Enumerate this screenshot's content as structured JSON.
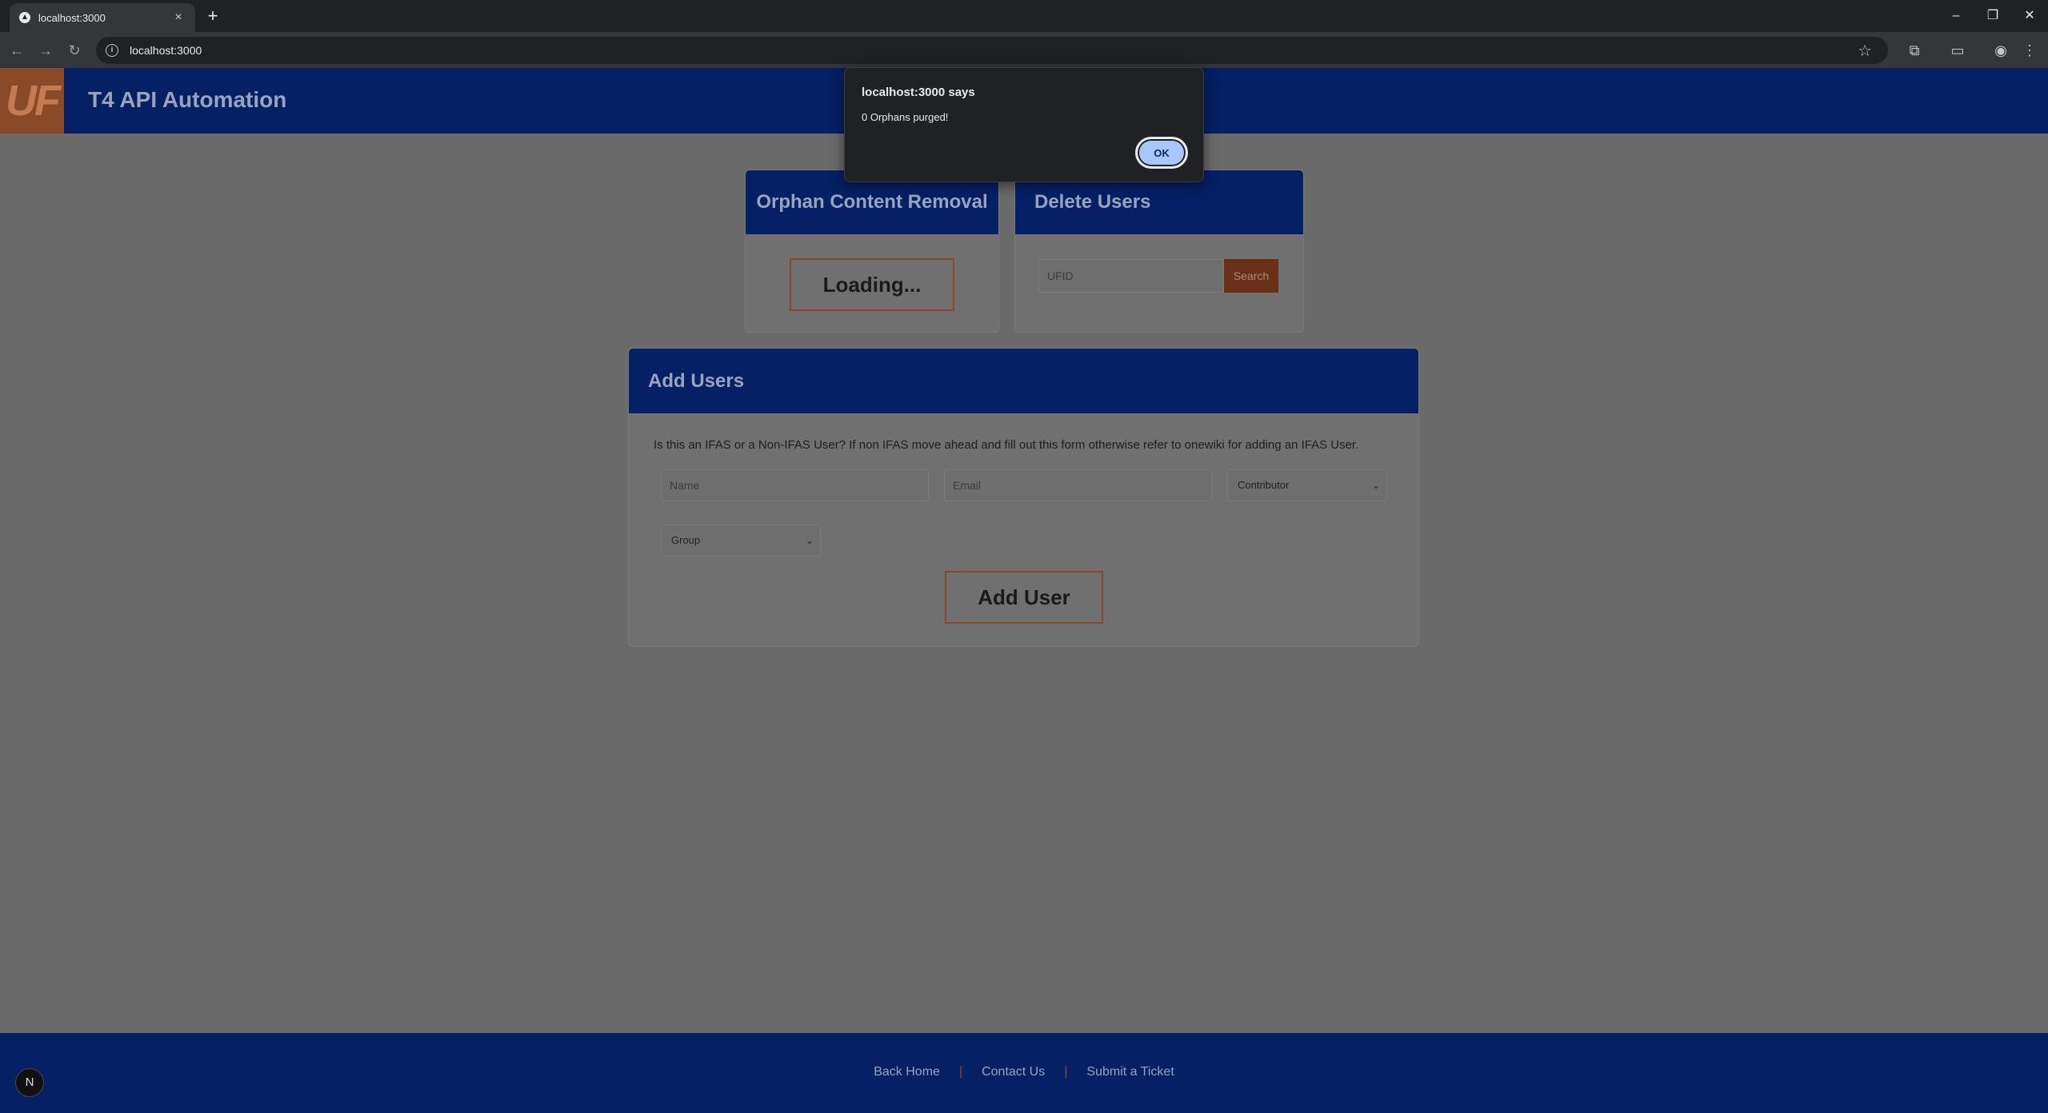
{
  "browser": {
    "tab_title": "localhost:3000",
    "url": "localhost:3000",
    "new_tab": "+",
    "close_tab": "×"
  },
  "header": {
    "logo": "UF",
    "title": "T4 API Automation"
  },
  "orphan_card": {
    "title": "Orphan Content Removal",
    "button_label": "Loading..."
  },
  "delete_card": {
    "title": "Delete Users",
    "ufid_placeholder": "UFID",
    "search_label": "Search"
  },
  "add_card": {
    "title": "Add Users",
    "description": "Is this an IFAS or a Non-IFAS User? If non IFAS move ahead and fill out this form otherwise refer to onewiki for adding an IFAS User.",
    "name_placeholder": "Name",
    "email_placeholder": "Email",
    "role_selected": "Contributor",
    "group_selected": "Group",
    "submit_label": "Add User"
  },
  "footer": {
    "links": [
      "Back Home",
      "Contact Us",
      "Submit a Ticket"
    ],
    "separator": "|",
    "badge": "N"
  },
  "dialog": {
    "title": "localhost:3000 says",
    "message": "0 Orphans purged!",
    "ok_label": "OK"
  },
  "colors": {
    "header_bg": "#052064",
    "accent_orange": "#8a4a2a",
    "dialog_ok": "#a8c7fa"
  }
}
